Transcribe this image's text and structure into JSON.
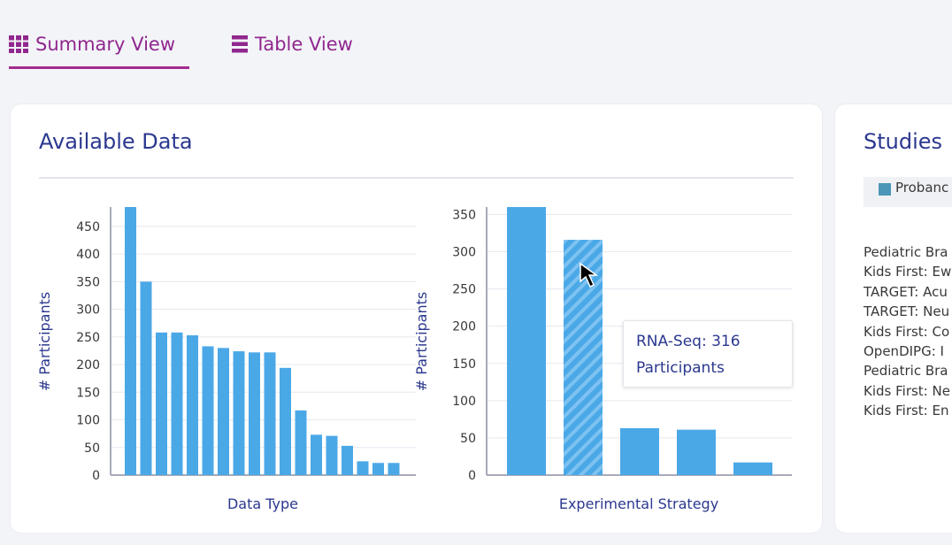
{
  "tabs": [
    {
      "label": "Summary View",
      "icon": "grid-icon",
      "active": true
    },
    {
      "label": "Table View",
      "icon": "list-icon",
      "active": false
    }
  ],
  "available_data": {
    "title": "Available Data",
    "tooltip": {
      "line1": "RNA-Seq: 316",
      "line2": "Participants"
    }
  },
  "studies": {
    "title": "Studies",
    "legend": "Probanc",
    "items": [
      "Pediatric Bra",
      "Kids First: Ew",
      "TARGET: Acu",
      "TARGET: Neu",
      "Kids First: Co",
      "OpenDIPG: I",
      "Pediatric Bra",
      "Kids First: Ne",
      "Kids First: En"
    ]
  },
  "colors": {
    "bar": "#4ba8e7",
    "accent": "#a42c90",
    "title": "#2b388f"
  },
  "chart_data": [
    {
      "type": "bar",
      "title": "",
      "xlabel": "Data Type",
      "ylabel": "# Participants",
      "ylim": [
        0,
        485
      ],
      "yticks": [
        0,
        50,
        100,
        150,
        200,
        250,
        300,
        350,
        400,
        450
      ],
      "values": [
        485,
        350,
        258,
        258,
        253,
        233,
        230,
        224,
        222,
        222,
        194,
        117,
        73,
        71,
        53,
        25,
        22,
        22
      ],
      "highlight": null
    },
    {
      "type": "bar",
      "title": "",
      "xlabel": "Experimental Strategy",
      "ylabel": "# Participants",
      "ylim": [
        0,
        360
      ],
      "yticks": [
        0,
        50,
        100,
        150,
        200,
        250,
        300,
        350
      ],
      "values": [
        360,
        316,
        63,
        61,
        17
      ],
      "highlight": 1
    }
  ]
}
